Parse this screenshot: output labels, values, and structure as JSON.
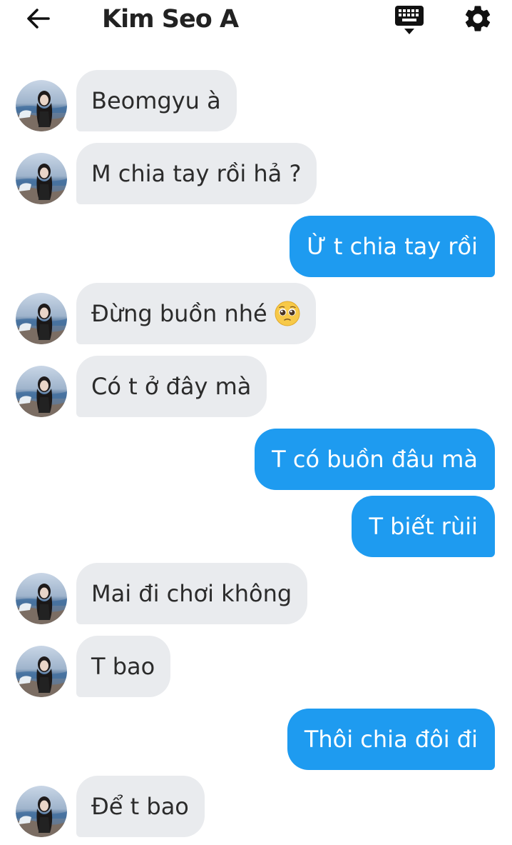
{
  "header": {
    "back_icon": "arrow-left-icon",
    "title": "Kim Seo A",
    "keyboard_icon": "keyboard-icon",
    "settings_icon": "gear-icon"
  },
  "colors": {
    "incoming_bubble": "#e9ebee",
    "outgoing_bubble": "#1e9bf0",
    "outgoing_text": "#ffffff",
    "incoming_text": "#2b2b2b"
  },
  "messages": [
    {
      "from": "them",
      "text": "Beomgyu à"
    },
    {
      "from": "them",
      "text": "M chia tay rồi hả ?"
    },
    {
      "from": "me",
      "text": "Ừ t chia tay rồi"
    },
    {
      "from": "them",
      "text": "Đừng buồn nhé",
      "emoji": "pleading-face-icon"
    },
    {
      "from": "them",
      "text": "Có t ở đây mà"
    },
    {
      "from": "me",
      "text": "T có buồn đâu mà"
    },
    {
      "from": "me",
      "text": "T biết rùii"
    },
    {
      "from": "them",
      "text": "Mai đi chơi không"
    },
    {
      "from": "them",
      "text": "T bao"
    },
    {
      "from": "me",
      "text": "Thôi chia đôi đi"
    },
    {
      "from": "them",
      "text": "Để t bao"
    }
  ]
}
